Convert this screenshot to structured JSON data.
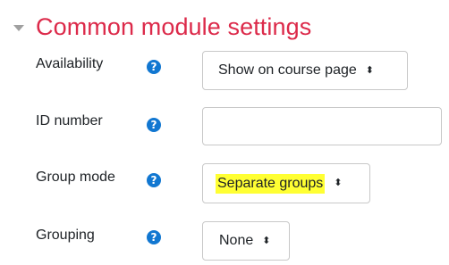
{
  "section": {
    "title": "Common module settings",
    "collapse_icon": "caret-down-icon"
  },
  "fields": {
    "availability": {
      "label": "Availability",
      "value": "Show on course page",
      "help_icon": "question-circle-icon"
    },
    "idnumber": {
      "label": "ID number",
      "value": "",
      "help_icon": "question-circle-icon"
    },
    "groupmode": {
      "label": "Group mode",
      "value": "Separate groups",
      "help_icon": "question-circle-icon"
    },
    "grouping": {
      "label": "Grouping",
      "value": "None",
      "help_icon": "question-circle-icon"
    }
  },
  "select_arrow_icon": "up-down-arrows-icon",
  "help_icon_glyph": "?",
  "select_arrow_glyph": "⬍",
  "colors": {
    "title": "#dc2a4a",
    "help_icon": "#1177d1",
    "highlight": "#ffff33",
    "border": "#c8c8c8"
  }
}
